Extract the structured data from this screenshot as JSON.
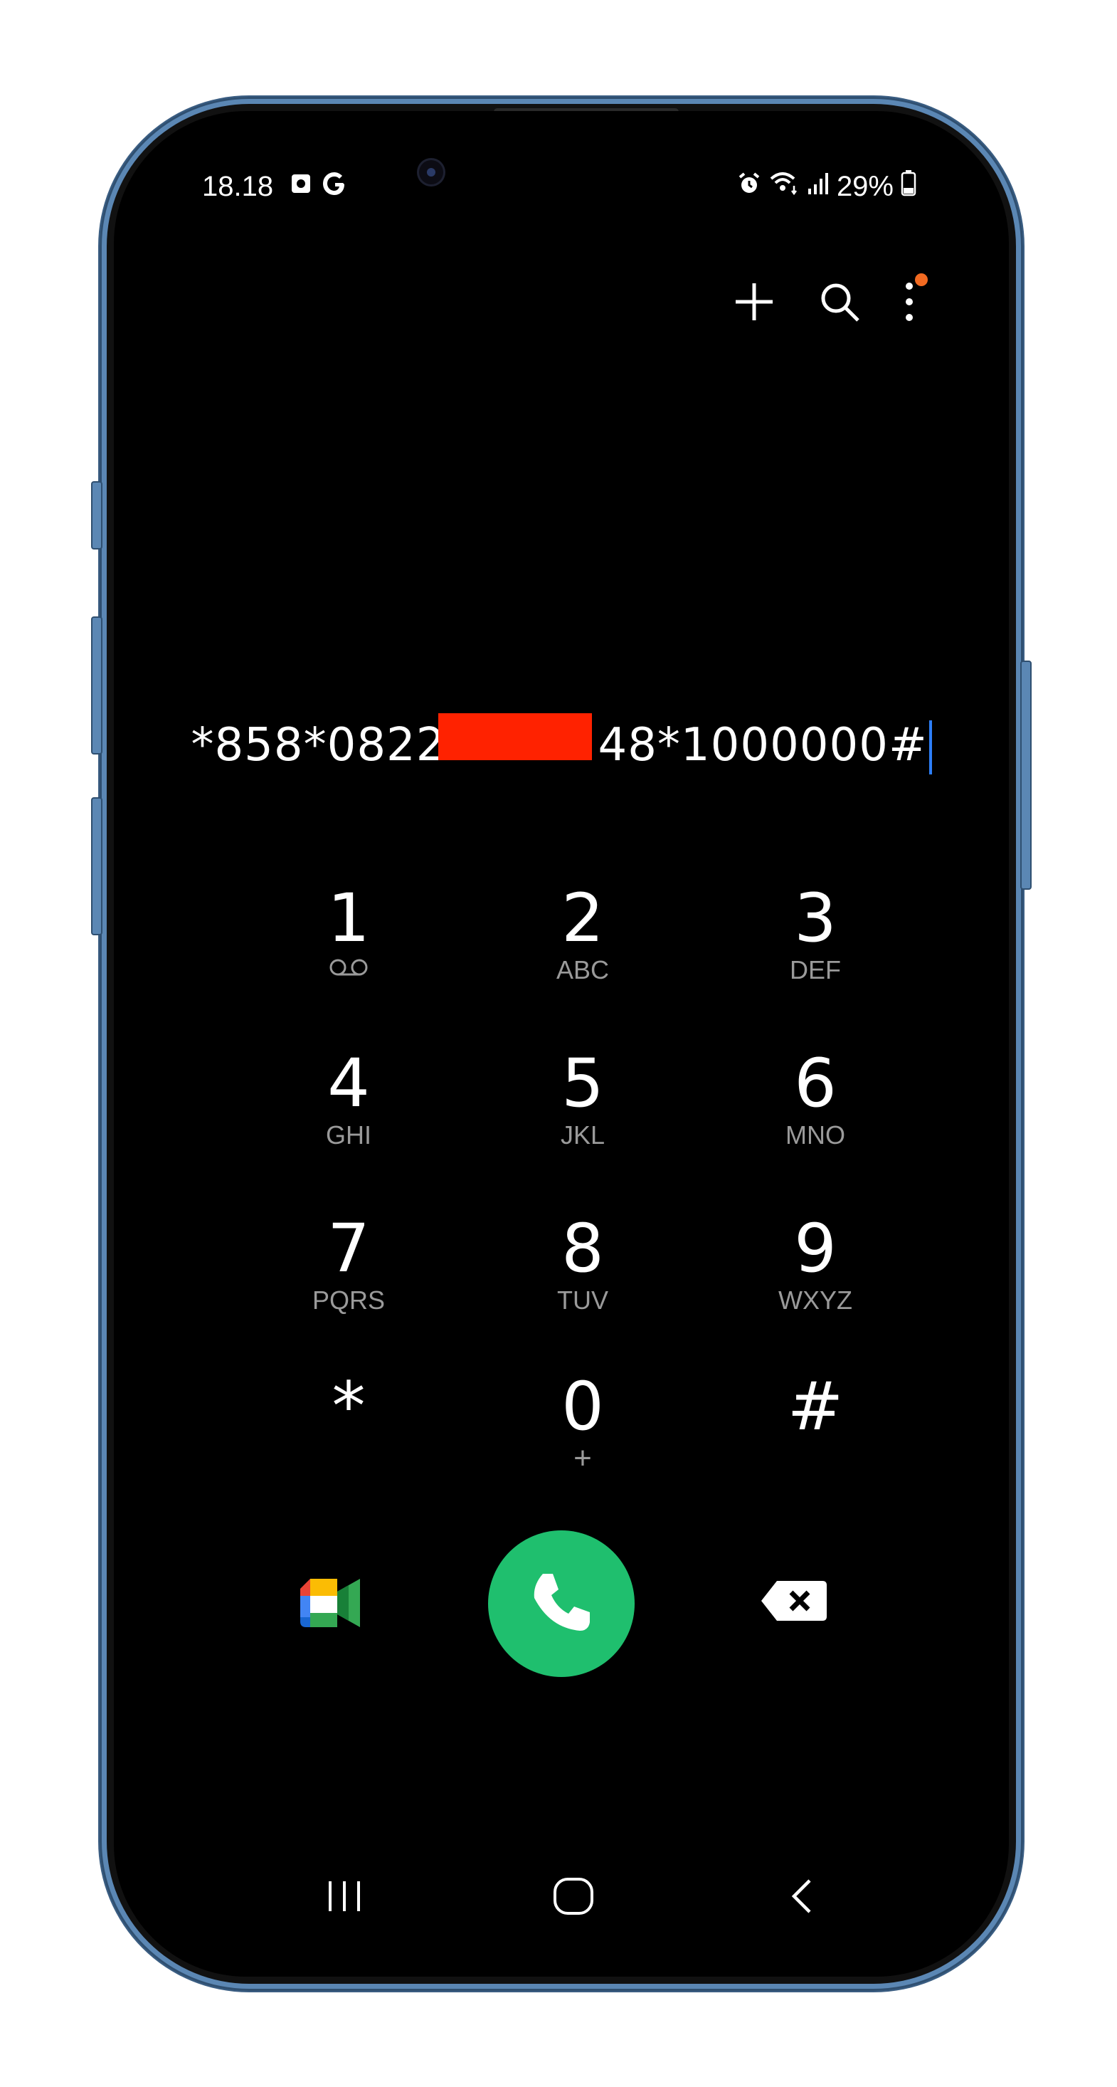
{
  "status_bar": {
    "time": "18.18",
    "battery": "29%",
    "left_icons": [
      "notification-icon",
      "google-icon"
    ],
    "right_icons": [
      "alarm-icon",
      "wifi-icon",
      "signal-icon",
      "battery-icon"
    ]
  },
  "app_bar": {
    "icons": [
      "add-icon",
      "search-icon",
      "more-options-icon"
    ],
    "notification_dot_color": "#f26a21"
  },
  "dialer": {
    "number_prefix": "*858*0822",
    "number_suffix": "48*1000000#",
    "redaction_color": "#ff2200",
    "cursor_color": "#2d7ef7"
  },
  "keypad": {
    "keys": [
      {
        "digit": "1",
        "letters": ""
      },
      {
        "digit": "2",
        "letters": "ABC"
      },
      {
        "digit": "3",
        "letters": "DEF"
      },
      {
        "digit": "4",
        "letters": "GHI"
      },
      {
        "digit": "5",
        "letters": "JKL"
      },
      {
        "digit": "6",
        "letters": "MNO"
      },
      {
        "digit": "7",
        "letters": "PQRS"
      },
      {
        "digit": "8",
        "letters": "TUV"
      },
      {
        "digit": "9",
        "letters": "WXYZ"
      },
      {
        "digit": "*",
        "letters": ""
      },
      {
        "digit": "0",
        "letters": "+"
      },
      {
        "digit": "#",
        "letters": ""
      }
    ]
  },
  "actions": {
    "call_color": "#1fbf6e",
    "icons": [
      "google-meet-icon",
      "phone-icon",
      "backspace-icon"
    ]
  },
  "nav_bar": {
    "icons": [
      "recents-icon",
      "home-icon",
      "back-icon"
    ]
  },
  "colors": {
    "frame": "#5b87b4",
    "screen": "#000000"
  }
}
